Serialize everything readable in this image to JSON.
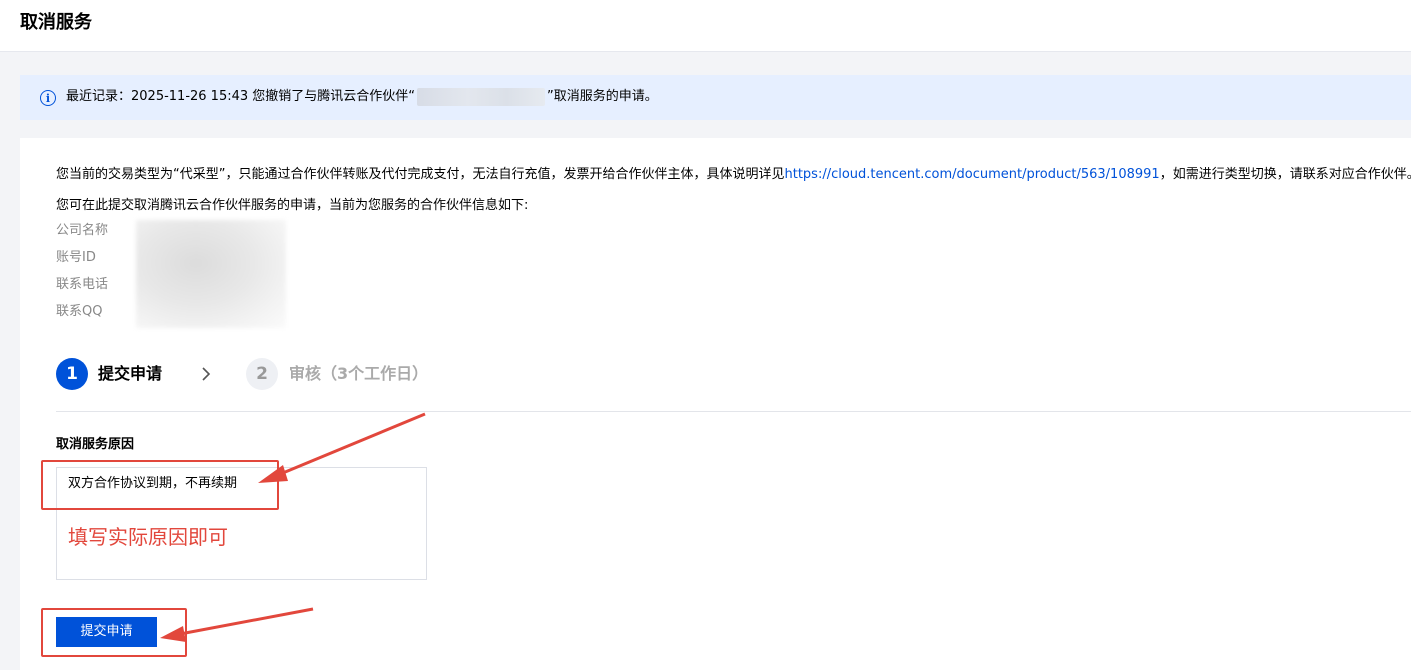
{
  "header": {
    "title": "取消服务"
  },
  "notice": {
    "icon": "info-icon",
    "text_before": "最近记录：2025-11-26 15:43 您撤销了与腾讯云合作伙伴“",
    "text_after": "”取消服务的申请。"
  },
  "description": {
    "line1_before": "您当前的交易类型为“代采型”，只能通过合作伙伴转账及代付完成支付，无法自行充值，发票开给合作伙伴主体，具体说明详见",
    "link": "https://cloud.tencent.com/document/product/563/108991",
    "line1_after": "，如需进行类型切换，请联系对应合作伙伴。",
    "line2": "您可在此提交取消腾讯云合作伙伴服务的申请，当前为您服务的合作伙伴信息如下:"
  },
  "partner_info": {
    "labels": [
      "公司名称",
      "账号ID",
      "联系电话",
      "联系QQ"
    ]
  },
  "steps": {
    "step1_number": "1",
    "step1_label": "提交申请",
    "step2_number": "2",
    "step2_label": "审核（3个工作日）"
  },
  "form": {
    "reason_label": "取消服务原因",
    "reason_value": "双方合作协议到期，不再续期",
    "annotation": "填写实际原因即可",
    "submit_label": "提交申请"
  },
  "colors": {
    "primary": "#0052d9",
    "annotation": "#e2473c",
    "notice_bg": "#e6efff"
  }
}
